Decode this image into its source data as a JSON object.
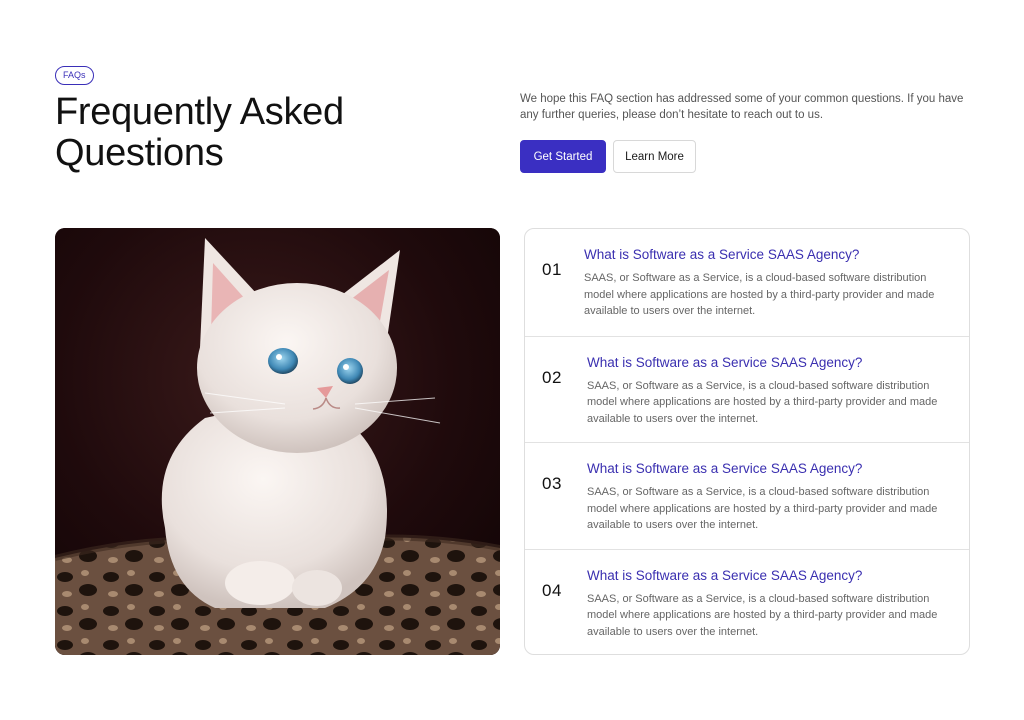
{
  "header": {
    "badge": "FAQs",
    "title": "Frequently Asked Questions",
    "intro": "We hope this FAQ section has addressed some of your common questions. If you have any further queries, please don’t hesitate to reach out to us.",
    "primary_button": "Get Started",
    "secondary_button": "Learn More"
  },
  "colors": {
    "accent": "#3a2fc2",
    "question_text": "#3a2fb0",
    "body_text": "#666666"
  },
  "image": {
    "subject": "white-kitten-photo"
  },
  "faqs": [
    {
      "number": "01",
      "question": "What is Software as a Service SAAS Agency?",
      "answer": "SAAS, or Software as a Service, is a cloud-based software distribution model where applications are hosted by a third-party provider and made available to users over the internet."
    },
    {
      "number": "02",
      "question": "What is Software as a Service SAAS Agency?",
      "answer": "SAAS, or Software as a Service, is a cloud-based software distribution model where applications are hosted by a third-party provider and made available to users over the internet."
    },
    {
      "number": "03",
      "question": "What is Software as a Service SAAS Agency?",
      "answer": "SAAS, or Software as a Service, is a cloud-based software distribution model where applications are hosted by a third-party provider and made available to users over the internet."
    },
    {
      "number": "04",
      "question": "What is Software as a Service SAAS Agency?",
      "answer": "SAAS, or Software as a Service, is a cloud-based software distribution model where applications are hosted by a third-party provider and made available to users over the internet."
    }
  ]
}
